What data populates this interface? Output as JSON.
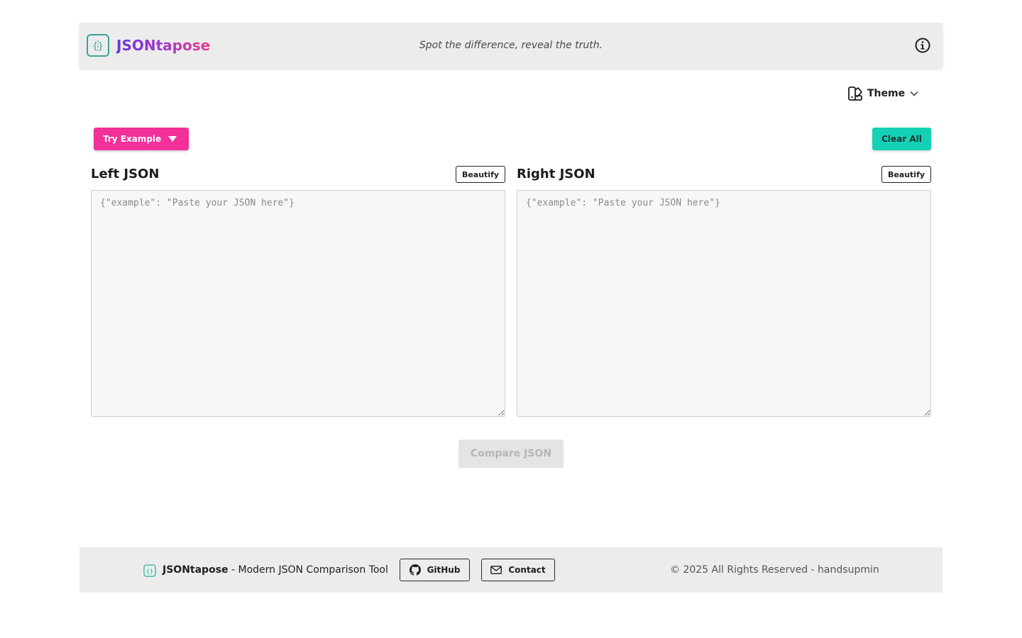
{
  "header": {
    "brand_part1": "JSON",
    "brand_part2": "tapose",
    "tagline": "Spot the difference, reveal the truth.",
    "info_icon": "info-circle-icon",
    "logo_icon": "json-braces-icon"
  },
  "theme": {
    "label": "Theme",
    "icon": "palette-icon"
  },
  "toolbar": {
    "try_example_label": "Try Example",
    "clear_all_label": "Clear All"
  },
  "left_panel": {
    "title": "Left JSON",
    "beautify_label": "Beautify",
    "placeholder": "{\"example\": \"Paste your JSON here\"}",
    "value": ""
  },
  "right_panel": {
    "title": "Right JSON",
    "beautify_label": "Beautify",
    "placeholder": "{\"example\": \"Paste your JSON here\"}",
    "value": ""
  },
  "compare": {
    "label": "Compare JSON",
    "disabled": true
  },
  "footer": {
    "brand": "JSONtapose",
    "brand_suffix": " - Modern JSON Comparison Tool",
    "github_label": "GitHub",
    "contact_label": "Contact",
    "copyright": "© 2025 All Rights Reserved - handsupmin"
  },
  "colors": {
    "accent_pink": "#f2309a",
    "accent_teal": "#14d1b6",
    "brand_purple": "#6a35d8",
    "brand_pink": "#e93b8f"
  }
}
